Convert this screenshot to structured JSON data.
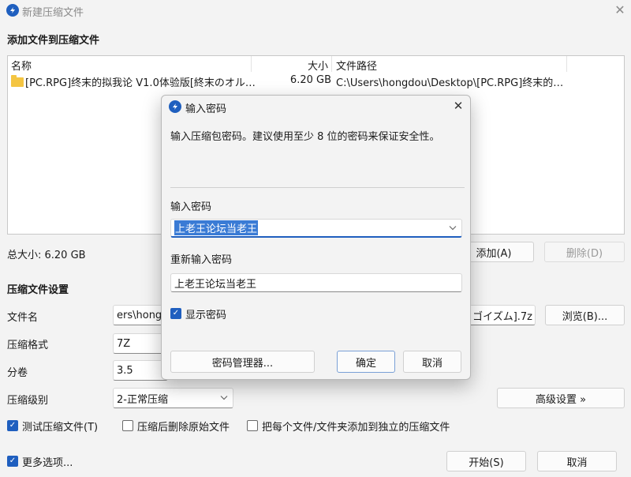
{
  "window": {
    "title": "新建压缩文件",
    "close_glyph": "✕"
  },
  "files_section": {
    "title": "添加文件到压缩文件",
    "columns": [
      "名称",
      "大小",
      "文件路径"
    ],
    "rows": [
      {
        "name": "[PC.RPG]终末的拟我论 V1.0体验版[終末のオル…",
        "size": "6.20 GB",
        "path": "C:\\Users\\hongdou\\Desktop\\[PC.RPG]终末的…"
      }
    ],
    "total_size": "总大小: 6.20 GB",
    "add_button": "添加(A)",
    "delete_button": "删除(D)"
  },
  "settings_section": {
    "title": "压缩文件设置",
    "filename_label": "文件名",
    "filename_value_left": "ers\\hong",
    "filename_value_right": "ゴイズム].7z",
    "browse_button": "浏览(B)...",
    "format_label": "压缩格式",
    "format_value": "7Z",
    "volume_label": "分卷",
    "volume_value": "3.5",
    "level_label": "压缩级别",
    "level_value": "2-正常压缩",
    "advanced_button": "高级设置 »",
    "test_checkbox": "测试压缩文件(T)",
    "delete_after_checkbox": "压缩后删除原始文件",
    "separate_checkbox": "把每个文件/文件夹添加到独立的压缩文件",
    "more_options_checkbox": "更多选项...",
    "start_button": "开始(S)",
    "cancel_button": "取消"
  },
  "dialog": {
    "title": "输入密码",
    "close_glyph": "✕",
    "description": "输入压缩包密码。建议使用至少 8 位的密码来保证安全性。",
    "password_label": "输入密码",
    "password_value": "上老王论坛当老王",
    "reenter_label": "重新输入密码",
    "reenter_value": "上老王论坛当老王",
    "show_password_checkbox": "显示密码",
    "manager_button": "密码管理器...",
    "ok_button": "确定",
    "cancel_button": "取消"
  },
  "icons": {
    "checkmark": "✓",
    "chevron_down": "⌄"
  }
}
